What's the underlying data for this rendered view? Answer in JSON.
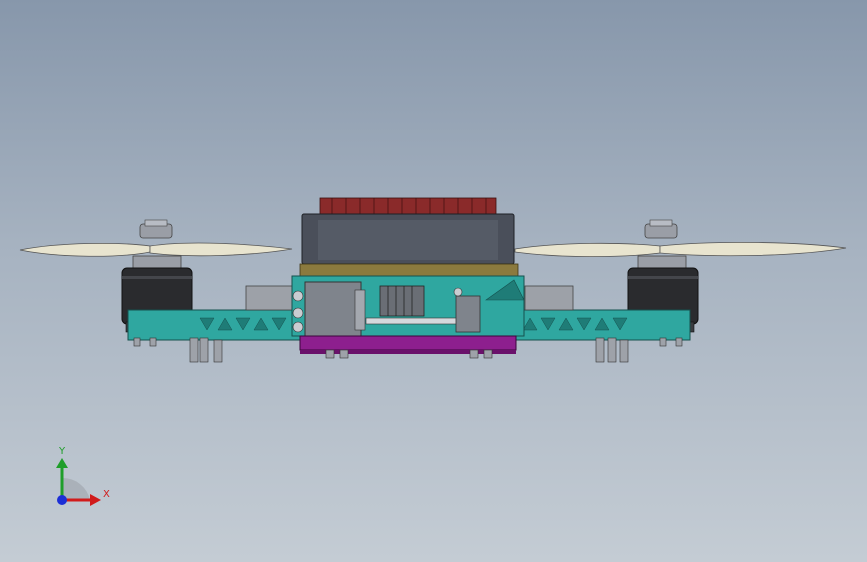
{
  "triad": {
    "y_label": "Y",
    "x_label": "X",
    "y_color": "#1f9e2a",
    "x_color": "#d11b1b",
    "z_color": "#1c2fd6"
  },
  "palette": {
    "frame": "#2fa7a0",
    "frame_dark": "#1f7c77",
    "motor": "#2a2b2e",
    "prop": "#e8e4cf",
    "top_board": "#4a4f5a",
    "heatsink": "#8a2a2a",
    "bottom_plate": "#8d1f8e",
    "wood": "#8b7a3e"
  }
}
